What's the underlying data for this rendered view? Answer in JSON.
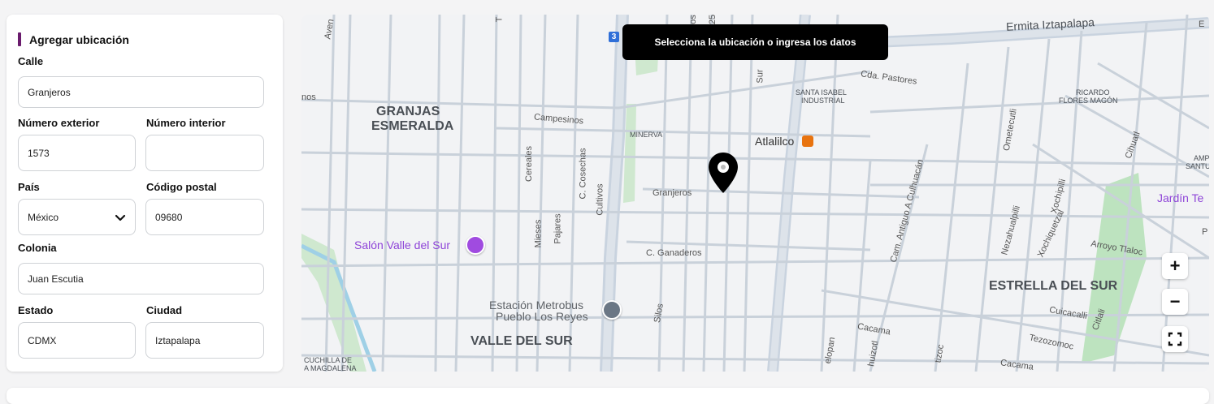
{
  "form": {
    "title": "Agregar ubicación",
    "calle": {
      "label": "Calle",
      "value": "Granjeros"
    },
    "numero_exterior": {
      "label": "Número exterior",
      "value": "1573"
    },
    "numero_interior": {
      "label": "Número interior",
      "value": ""
    },
    "pais": {
      "label": "País",
      "value": "México"
    },
    "codigo_postal": {
      "label": "Código postal",
      "value": "09680"
    },
    "colonia": {
      "label": "Colonia",
      "value": "Juan Escutia"
    },
    "estado": {
      "label": "Estado",
      "value": "CDMX"
    },
    "ciudad": {
      "label": "Ciudad",
      "value": "Iztapalapa"
    }
  },
  "map": {
    "tooltip": "Selecciona la ubicación o ingresa los datos",
    "zoom_in": "+",
    "zoom_out": "−",
    "labels": {
      "granjas": "GRANJAS",
      "esmeralda": "ESMERALDA",
      "valle_del_sur": "VALLE DEL SUR",
      "estrella_del_sur": "ESTRELLA DEL SUR",
      "santa_isabel": "SANTA ISABEL",
      "industrial": "INDUSTRIAL",
      "ricardo": "RICARDO",
      "flores_magon": "FLORES MAGÓN",
      "minerva": "MINERVA",
      "cuchilla_de": "CUCHILLA DE",
      "a_magdalena": "A MAGDALENA",
      "amp": "AMP",
      "santu": "SANTU",
      "ermita": "Ermita Iztapalapa",
      "cda_pastores": "Cda. Pastores",
      "campesinos": "Campesinos",
      "granjeros": "Granjeros",
      "ganaderos": "C. Ganaderos",
      "atlalilco": "Atlalilco",
      "salon": "Salón Valle del Sur",
      "estacion": "Estación Metrobus",
      "pueblo": "Pueblo Los Reyes",
      "jardin": "Jardín Te",
      "arroyo": "Arroyo Tlaloc",
      "cereales": "Cereales",
      "cosechas": "C. Cosechas",
      "cultivos": "Cultivos",
      "mieses": "Mieses",
      "pajares": "Pajares",
      "silos": "Silos",
      "cam_antiguo": "Cam. Antiguo A Culhuacán",
      "ometecutli": "Ometecutli",
      "xochipilli": "Xochipilli",
      "nezahualpilli": "Nezahualpilli",
      "xochiquetzal": "Xochiquetzal",
      "cihuatl": "Cihuatl",
      "cuicacalli": "Cuicacalli",
      "citlali": "Citlali",
      "tezozomoc": "Tezozomoc",
      "cacama": "Cacama",
      "cacama2": "Cacama",
      "aven": "Aven",
      "nos": "nos",
      "sur": "Sur",
      "metro_badge": "3",
      "short_25": "25",
      "short_os": "os",
      "short_te": "T",
      "short_e": "E",
      "short_p": "P",
      "short_el": "elopan",
      "short_hu": "huizotl",
      "short_iz": "tizoc"
    }
  }
}
